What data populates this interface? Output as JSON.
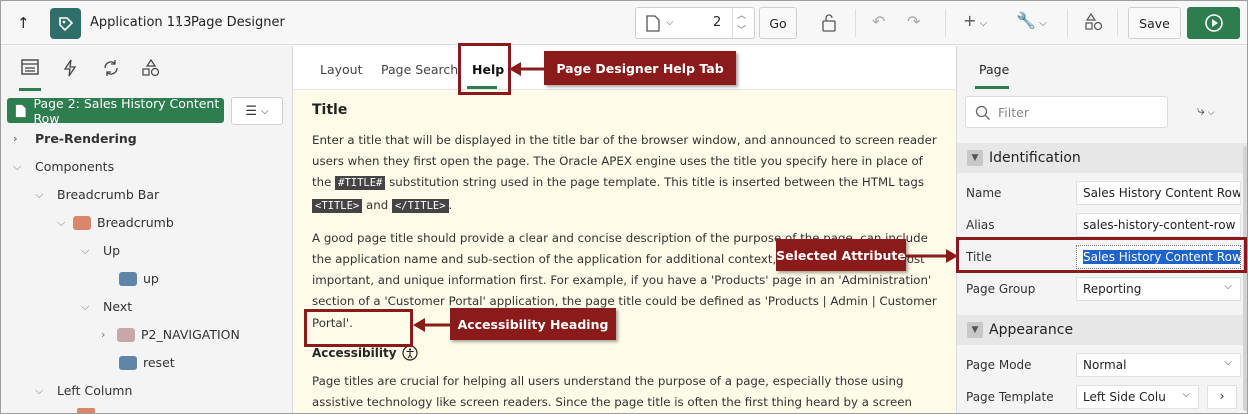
{
  "header": {
    "app_name": "Application 113",
    "separator": "\\",
    "page_title": "Page Designer",
    "page_number": "2",
    "go_label": "Go",
    "save_label": "Save"
  },
  "left": {
    "tabs": [
      "rendering-icon",
      "dynamic-actions-icon",
      "processing-icon",
      "shared-components-icon"
    ],
    "page_chip": "Page 2: Sales History Content Row",
    "tree": {
      "pre_rendering": "Pre-Rendering",
      "components": "Components",
      "breadcrumb_bar": "Breadcrumb Bar",
      "breadcrumb": "Breadcrumb",
      "up": "Up",
      "up_item": "up",
      "next": "Next",
      "p2_nav": "P2_NAVIGATION",
      "reset": "reset",
      "left_column": "Left Column"
    }
  },
  "center": {
    "tabs": {
      "layout": "Layout",
      "page_search": "Page Search",
      "help": "Help"
    },
    "help": {
      "title": "Title",
      "p1_a": "Enter a title that will be displayed in the title bar of the browser window, and announced to screen reader users when they first open the page. The Oracle APEX engine uses the title you specify here in place of the ",
      "p1_code1": "#TITLE#",
      "p1_b": " substitution string used in the page template. This title is inserted between the HTML tags ",
      "p1_code2": "<TITLE>",
      "p1_c": " and ",
      "p1_code3": "</TITLE>",
      "p1_d": ".",
      "p2": "A good page title should provide a clear and concise description of the purpose of the page, can include the application name and sub-section of the application for additional context, and should put the most important, and unique information first. For example, if you have a 'Products' page in an 'Administration' section of a 'Customer Portal' application, the page title could be defined as 'Products | Admin | Customer Portal'.",
      "accessibility": "Accessibility",
      "p3": "Page titles are crucial for helping all users understand the purpose of a page, especially those using assistive technology like screen readers. Since the page title is often the first thing heard by a screen reader user, it's essential to make sure every page title is meaningful and unique."
    }
  },
  "right": {
    "tab": "Page",
    "filter_placeholder": "Filter",
    "identification": "Identification",
    "appearance": "Appearance",
    "props": {
      "name_label": "Name",
      "name_value": "Sales History Content Row",
      "alias_label": "Alias",
      "alias_value": "sales-history-content-row",
      "title_label": "Title",
      "title_value": "Sales History Content Row",
      "group_label": "Page Group",
      "group_value": "Reporting",
      "mode_label": "Page Mode",
      "mode_value": "Normal",
      "template_label": "Page Template",
      "template_value": "Left Side Colu"
    }
  },
  "callouts": {
    "help_tab": "Page Designer Help Tab",
    "selected_attr": "Selected Attribute",
    "acc_heading": "Accessibility Heading"
  },
  "colors": {
    "accent": "#2e7d4f",
    "callout": "#8b1a1a",
    "help_bg": "#fefbe8"
  }
}
